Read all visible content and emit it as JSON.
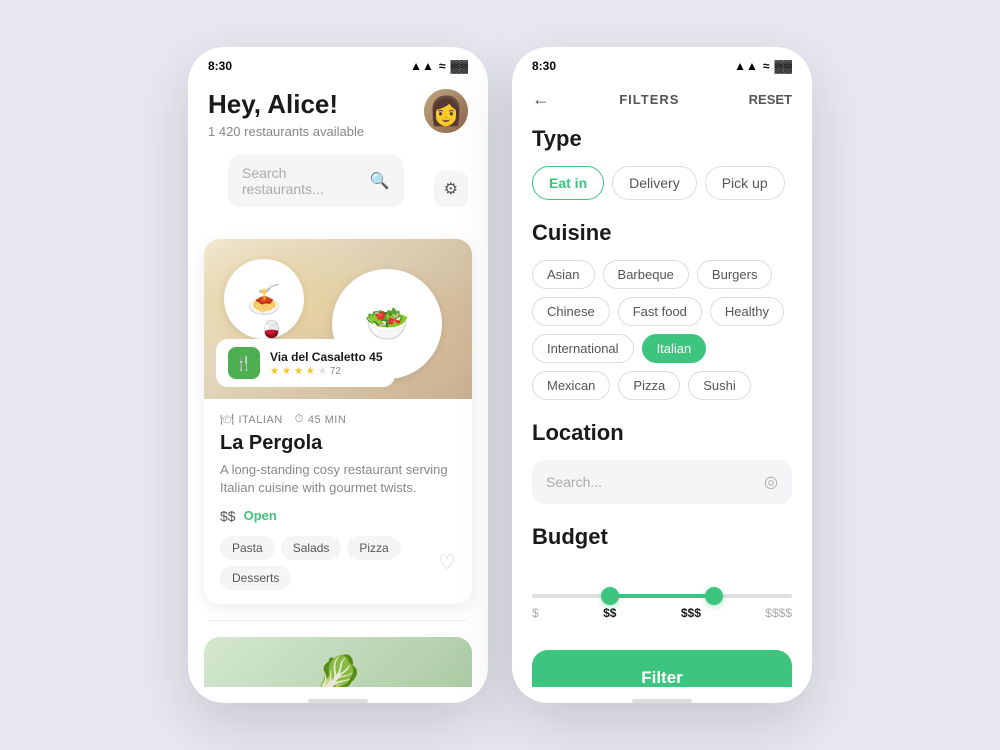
{
  "app": {
    "status_time": "8:30"
  },
  "phone1": {
    "greeting": "Hey, Alice!",
    "restaurants_count": "1 420 restaurants available",
    "search_placeholder": "Search restaurants...",
    "restaurant1": {
      "overlay_name": "Via del Casaletto 45",
      "rating": 3.5,
      "review_count": "72",
      "meta_cuisine": "ITALIAN",
      "meta_time": "45 MIN",
      "name": "La Pergola",
      "description": "A long-standing cosy restaurant serving Italian cuisine with gourmet twists.",
      "price": "$$",
      "status": "Open",
      "tags": [
        "Pasta",
        "Salads",
        "Pizza",
        "Desserts"
      ]
    }
  },
  "phone2": {
    "header_title": "FILTERS",
    "reset_label": "RESET",
    "type_section": {
      "title": "Type",
      "options": [
        {
          "label": "Eat in",
          "active": true
        },
        {
          "label": "Delivery",
          "active": false
        },
        {
          "label": "Pick up",
          "active": false
        }
      ]
    },
    "cuisine_section": {
      "title": "Cuisine",
      "chips": [
        {
          "label": "Asian",
          "selected": false
        },
        {
          "label": "Barbeque",
          "selected": false
        },
        {
          "label": "Burgers",
          "selected": false
        },
        {
          "label": "Chinese",
          "selected": false
        },
        {
          "label": "Fast food",
          "selected": false
        },
        {
          "label": "Healthy",
          "selected": false
        },
        {
          "label": "International",
          "selected": false
        },
        {
          "label": "Italian",
          "selected": true
        },
        {
          "label": "Mexican",
          "selected": false
        },
        {
          "label": "Pizza",
          "selected": false
        },
        {
          "label": "Sushi",
          "selected": false
        }
      ]
    },
    "location_section": {
      "title": "Location",
      "search_placeholder": "Search..."
    },
    "budget_section": {
      "title": "Budget",
      "labels": [
        "$",
        "$$",
        "$$$",
        "$$$$"
      ]
    },
    "filter_button_label": "Filter"
  }
}
